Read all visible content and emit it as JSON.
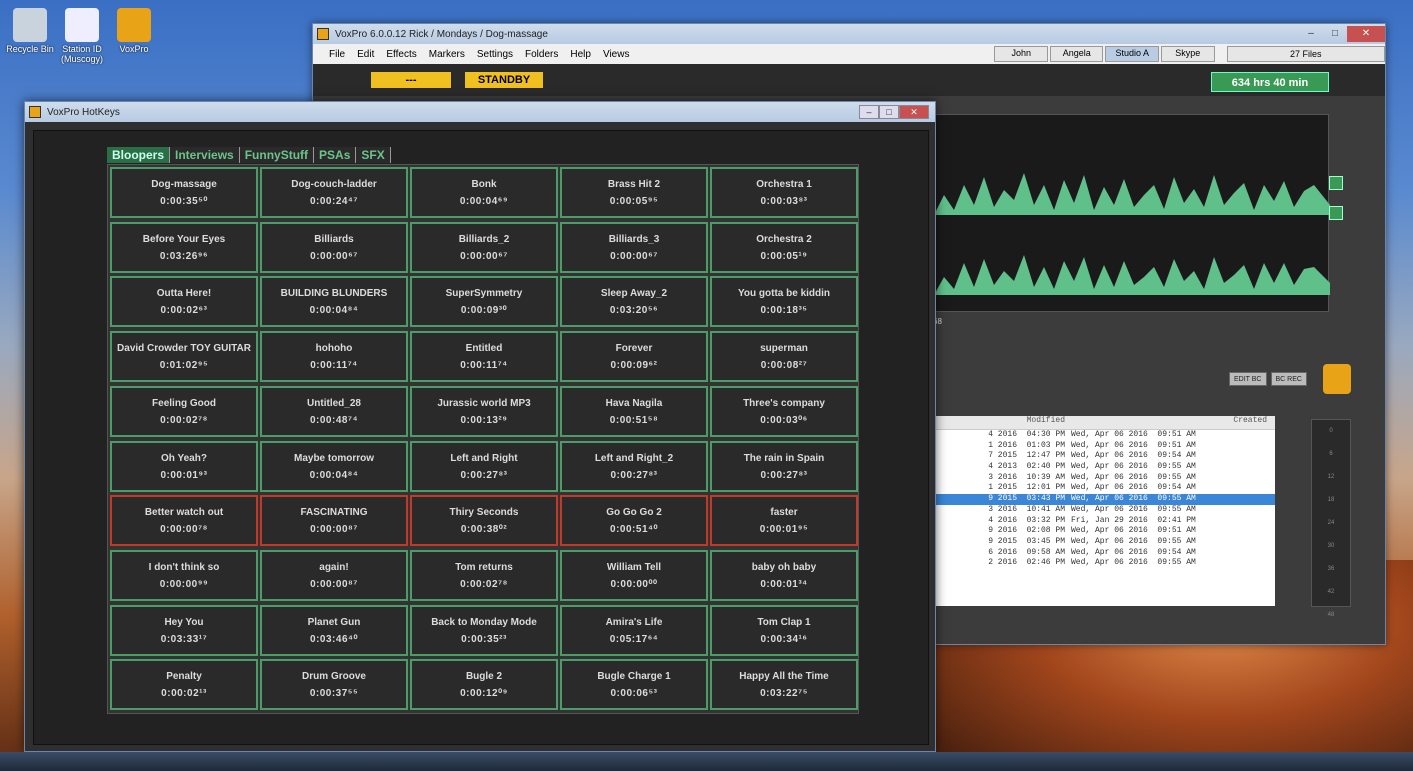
{
  "desktop": {
    "icons": [
      {
        "label": "Recycle Bin"
      },
      {
        "label": "Station ID (Muscogy)"
      },
      {
        "label": "VoxPro"
      }
    ]
  },
  "main_window": {
    "title": "VoxPro 6.0.0.12  Rick / Mondays / Dog-massage",
    "controls": [
      "–",
      "□",
      "✕"
    ],
    "menu": [
      "File",
      "Edit",
      "Effects",
      "Markers",
      "Settings",
      "Folders",
      "Help",
      "Views"
    ],
    "users": [
      "John",
      "Angela",
      "Studio A",
      "Skype"
    ],
    "active_user": "Studio A",
    "files": "27 Files",
    "status_box": "---",
    "standby": "STANDBY",
    "hours": "634 hrs  40 min",
    "wave_time": "68",
    "bc_buttons": [
      "EDIT BC",
      "BC REC"
    ],
    "table": {
      "col_modified": "Modified",
      "col_created": "Created",
      "rows": [
        [
          "4 2016  04:30 PM",
          "Wed, Apr 06 2016  09:51 AM"
        ],
        [
          "1 2016  01:03 PM",
          "Wed, Apr 06 2016  09:51 AM"
        ],
        [
          "7 2015  12:47 PM",
          "Wed, Apr 06 2016  09:54 AM"
        ],
        [
          "4 2013  02:40 PM",
          "Wed, Apr 06 2016  09:55 AM"
        ],
        [
          "3 2016  10:39 AM",
          "Wed, Apr 06 2016  09:55 AM"
        ],
        [
          "1 2015  12:01 PM",
          "Wed, Apr 06 2016  09:54 AM"
        ],
        [
          "9 2015  03:43 PM",
          "Wed, Apr 06 2016  09:55 AM"
        ],
        [
          "3 2016  10:41 AM",
          "Wed, Apr 06 2016  09:55 AM"
        ],
        [
          "4 2016  03:32 PM",
          "Fri, Jan 29 2016  02:41 PM"
        ],
        [
          "9 2016  02:08 PM",
          "Wed, Apr 06 2016  09:51 AM"
        ],
        [
          "9 2015  03:45 PM",
          "Wed, Apr 06 2016  09:55 AM"
        ],
        [
          "6 2016  09:58 AM",
          "Wed, Apr 06 2016  09:54 AM"
        ],
        [
          "2 2016  02:46 PM",
          "Wed, Apr 06 2016  09:55 AM"
        ]
      ],
      "selected_row": 6
    },
    "meter_ticks": [
      "0",
      "6",
      "12",
      "18",
      "24",
      "30",
      "36",
      "42",
      "48"
    ]
  },
  "hotkeys_window": {
    "title": "VoxPro HotKeys",
    "controls": [
      "–",
      "□",
      "✕"
    ],
    "tabs": [
      "Bloopers",
      "Interviews",
      "FunnyStuff",
      "PSAs",
      "SFX"
    ],
    "active_tab": "Bloopers",
    "cells": [
      [
        "Dog-massage",
        "0:00:35⁵⁰"
      ],
      [
        "Dog-couch-ladder",
        "0:00:24⁴⁷"
      ],
      [
        "Bonk",
        "0:00:04⁶⁹"
      ],
      [
        "Brass Hit 2",
        "0:00:05⁹⁵"
      ],
      [
        "Orchestra 1",
        "0:00:03⁸³"
      ],
      [
        "Before Your Eyes",
        "0:03:26⁹⁶"
      ],
      [
        "Billiards",
        "0:00:00⁶⁷"
      ],
      [
        "Billiards_2",
        "0:00:00⁶⁷"
      ],
      [
        "Billiards_3",
        "0:00:00⁶⁷"
      ],
      [
        "Orchestra 2",
        "0:00:05¹⁹"
      ],
      [
        "Outta Here!",
        "0:00:02⁶³"
      ],
      [
        "BUILDING BLUNDERS",
        "0:00:04⁸⁴"
      ],
      [
        "SuperSymmetry",
        "0:00:09³⁰"
      ],
      [
        "Sleep Away_2",
        "0:03:20⁵⁶"
      ],
      [
        "You gotta be kiddin",
        "0:00:18³⁵"
      ],
      [
        "David Crowder TOY GUITAR",
        "0:01:02⁹⁵"
      ],
      [
        "hohoho",
        "0:00:11⁷⁴"
      ],
      [
        "Entitled",
        "0:00:11⁷⁴"
      ],
      [
        "Forever",
        "0:00:09⁶²"
      ],
      [
        "superman",
        "0:00:08²⁷"
      ],
      [
        "Feeling Good",
        "0:00:02⁷⁸"
      ],
      [
        "Untitled_28",
        "0:00:48⁷⁴"
      ],
      [
        "Jurassic world MP3",
        "0:00:13²⁹"
      ],
      [
        "Hava Nagila",
        "0:00:51⁵⁸"
      ],
      [
        "Three's company",
        "0:00:03⁰⁶"
      ],
      [
        "Oh Yeah?",
        "0:00:01⁹³"
      ],
      [
        "Maybe tomorrow",
        "0:00:04⁸⁴"
      ],
      [
        "Left and Right",
        "0:00:27⁸³"
      ],
      [
        "Left and Right_2",
        "0:00:27⁸³"
      ],
      [
        "The rain in Spain",
        "0:00:27⁸³"
      ],
      [
        "Better watch out",
        "0:00:00⁷⁸"
      ],
      [
        "FASCINATING",
        "0:00:00⁸⁷"
      ],
      [
        "Thiry Seconds",
        "0:00:38⁰²"
      ],
      [
        "Go Go Go 2",
        "0:00:51⁴⁰"
      ],
      [
        "faster",
        "0:00:01⁹⁵"
      ],
      [
        "I don't think so",
        "0:00:00⁹⁹"
      ],
      [
        "again!",
        "0:00:00⁸⁷"
      ],
      [
        "Tom returns",
        "0:00:02⁷⁸"
      ],
      [
        "William Tell",
        "0:00:00⁰⁰"
      ],
      [
        "baby oh baby",
        "0:00:01³⁴"
      ],
      [
        "Hey You",
        "0:03:33¹⁷"
      ],
      [
        "Planet Gun",
        "0:03:46⁴⁰"
      ],
      [
        "Back to Monday Mode",
        "0:00:35²³"
      ],
      [
        "Amira's Life",
        "0:05:17⁶⁴"
      ],
      [
        "Tom Clap 1",
        "0:00:34¹⁶"
      ],
      [
        "Penalty",
        "0:00:02¹³"
      ],
      [
        "Drum Groove",
        "0:00:37⁵⁵"
      ],
      [
        "Bugle 2",
        "0:00:12⁰⁹"
      ],
      [
        "Bugle Charge 1",
        "0:00:06⁵³"
      ],
      [
        "Happy All the Time",
        "0:03:22⁷⁵"
      ]
    ],
    "red_row": 6
  }
}
